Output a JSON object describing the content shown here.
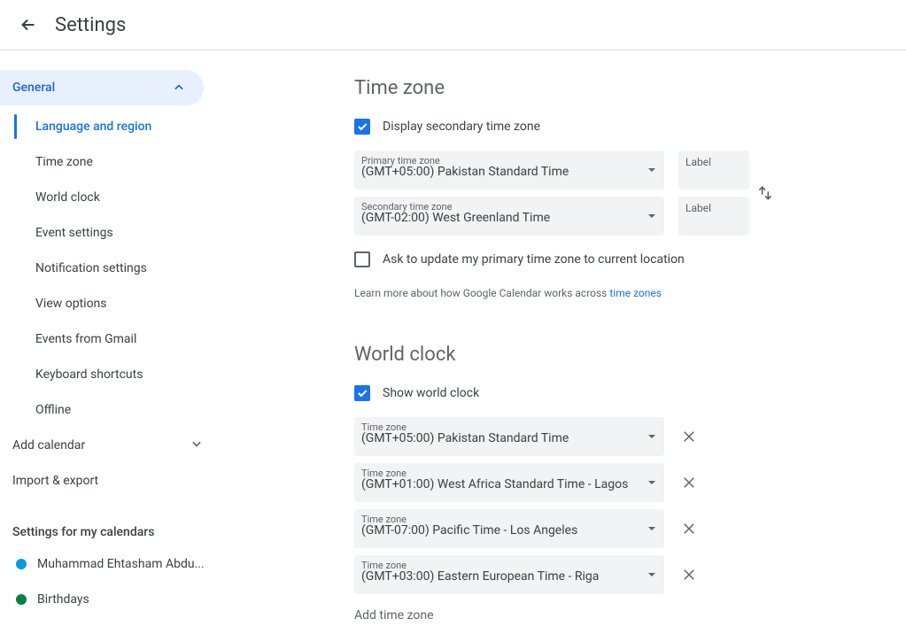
{
  "header": {
    "title": "Settings"
  },
  "sidebar": {
    "general_label": "General",
    "items": [
      {
        "label": "Language and region"
      },
      {
        "label": "Time zone"
      },
      {
        "label": "World clock"
      },
      {
        "label": "Event settings"
      },
      {
        "label": "Notification settings"
      },
      {
        "label": "View options"
      },
      {
        "label": "Events from Gmail"
      },
      {
        "label": "Keyboard shortcuts"
      },
      {
        "label": "Offline"
      }
    ],
    "add_calendar": "Add calendar",
    "import_export": "Import & export",
    "my_cal_heading": "Settings for my calendars",
    "calendars": [
      {
        "name": "Muhammad Ehtasham Abdu...",
        "color": "#039be5"
      },
      {
        "name": "Birthdays",
        "color": "#0b8043"
      }
    ]
  },
  "timezone": {
    "heading": "Time zone",
    "display_secondary_label": "Display secondary time zone",
    "primary_label": "Primary time zone",
    "primary_value": "(GMT+05:00) Pakistan Standard Time",
    "secondary_label": "Secondary time zone",
    "secondary_value": "(GMT-02:00) West Greenland Time",
    "label_placeholder": "Label",
    "ask_update_label": "Ask to update my primary time zone to current location",
    "hint_pre": "Learn more about how Google Calendar works across ",
    "hint_link": "time zones"
  },
  "worldclock": {
    "heading": "World clock",
    "show_label": "Show world clock",
    "tz_label": "Time zone",
    "zones": [
      "(GMT+05:00) Pakistan Standard Time",
      "(GMT+01:00) West Africa Standard Time - Lagos",
      "(GMT-07:00) Pacific Time - Los Angeles",
      "(GMT+03:00) Eastern European Time - Riga"
    ],
    "add_label": "Add time zone"
  }
}
